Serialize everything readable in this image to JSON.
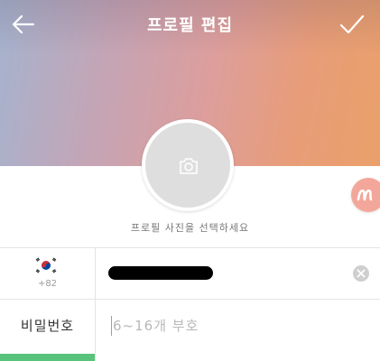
{
  "header": {
    "title": "프로필 편집",
    "back_icon": "arrow-left-icon",
    "done_icon": "checkmark-icon"
  },
  "profile": {
    "photo_icon": "camera-icon",
    "photo_caption": "프로필 사진을 선택하세요"
  },
  "phone": {
    "country_flag": "korea-flag-icon",
    "country_code": "+82",
    "value_redacted": true,
    "clear_icon": "clear-x-icon"
  },
  "password": {
    "label": "비밀번호",
    "placeholder": "6~16개 부호"
  },
  "floating_badge_icon": "m-logo-icon",
  "colors": {
    "accent_green": "#58c37a",
    "badge": "#f3a79a",
    "gradient_start": "#a5b3cf",
    "gradient_end": "#eaa06a"
  }
}
